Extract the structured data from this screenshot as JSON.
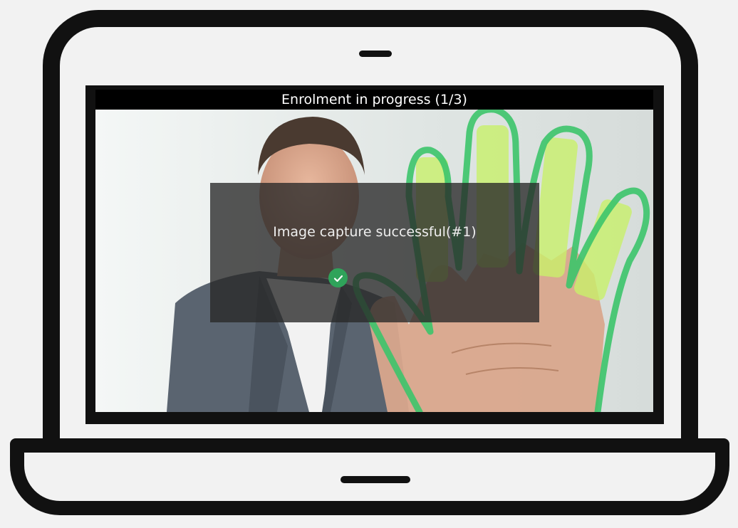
{
  "app": {
    "title": "Enrolment in progress (1/3)"
  },
  "dialog": {
    "message": "Image capture successful(#1)",
    "status_icon": "check-circle-icon",
    "status_color": "#2fa35a"
  },
  "overlay": {
    "guide_color": "#3cc46a",
    "finger_highlight_color": "#c8f06a"
  }
}
